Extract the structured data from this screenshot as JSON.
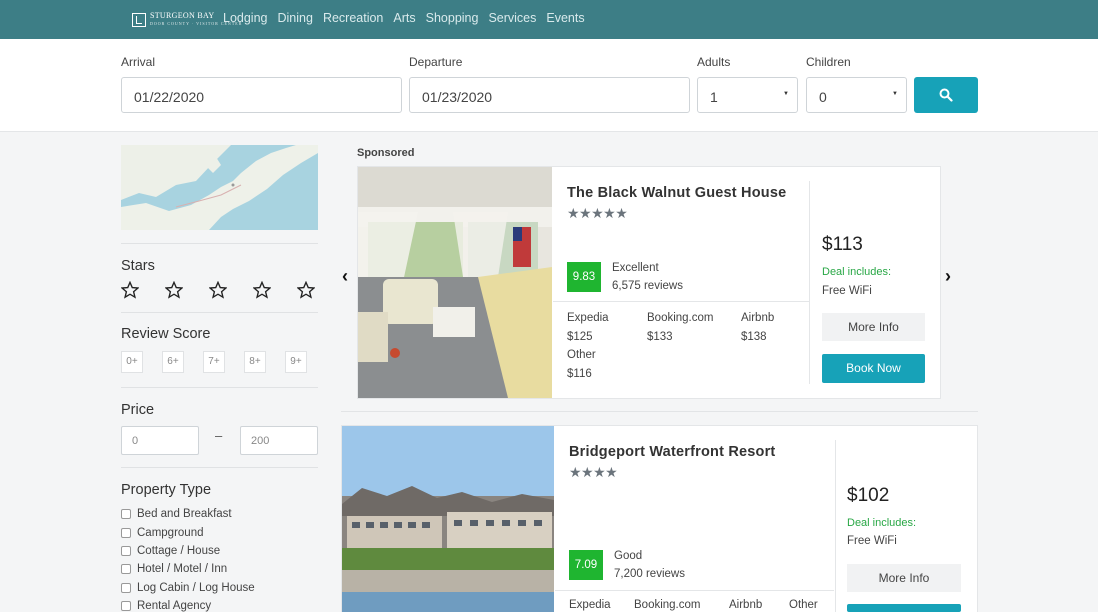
{
  "nav": {
    "logo_title": "STURGEON BAY",
    "logo_sub": "DOOR COUNTY · VISITOR CENTER",
    "items": [
      "Lodging",
      "Dining",
      "Recreation",
      "Arts",
      "Shopping",
      "Services",
      "Events"
    ]
  },
  "search": {
    "arrival_label": "Arrival",
    "arrival_value": "01/22/2020",
    "departure_label": "Departure",
    "departure_value": "01/23/2020",
    "adults_label": "Adults",
    "adults_value": "1",
    "children_label": "Children",
    "children_value": "0",
    "search_icon": "search-icon"
  },
  "sidebar": {
    "stars_title": "Stars",
    "review_title": "Review Score",
    "review_options": [
      "0+",
      "6+",
      "7+",
      "8+",
      "9+"
    ],
    "price_title": "Price",
    "price_min": "0",
    "price_dash": "–",
    "price_max": "200",
    "property_title": "Property Type",
    "property_types": [
      "Bed and Breakfast",
      "Campground",
      "Cottage / House",
      "Hotel / Motel / Inn",
      "Log Cabin / Log House",
      "Rental Agency"
    ]
  },
  "listings": {
    "sponsored_label": "Sponsored",
    "items": [
      {
        "name": "The Black Walnut Guest House",
        "stars": "★★★★★",
        "score": "9.83",
        "score_word": "Excellent",
        "reviews": "6,575 reviews",
        "ota": [
          {
            "site": "Expedia",
            "price": "$125"
          },
          {
            "site": "Booking.com",
            "price": "$133"
          },
          {
            "site": "Airbnb",
            "price": "$138"
          },
          {
            "site": "Other",
            "price": "$116"
          }
        ],
        "price": "$113",
        "deal_label": "Deal includes:",
        "deal_item": "Free WiFi",
        "more_label": "More Info",
        "book_label": "Book Now"
      },
      {
        "name": "Bridgeport Waterfront Resort",
        "stars": "★★★★",
        "score": "7.09",
        "score_word": "Good",
        "reviews": "7,200 reviews",
        "ota": [
          {
            "site": "Expedia"
          },
          {
            "site": "Booking.com"
          },
          {
            "site": "Airbnb"
          },
          {
            "site": "Other"
          }
        ],
        "price": "$102",
        "deal_label": "Deal includes:",
        "deal_item": "Free WiFi",
        "more_label": "More Info"
      }
    ]
  },
  "carousel": {
    "prev_icon": "chevron-left-icon",
    "next_icon": "chevron-right-icon",
    "prev_glyph": "‹",
    "next_glyph": "›"
  },
  "colors": {
    "nav_bg": "#3d7e86",
    "accent": "#17a2b8",
    "score_green": "#1fb530",
    "deal_green": "#28a745"
  }
}
